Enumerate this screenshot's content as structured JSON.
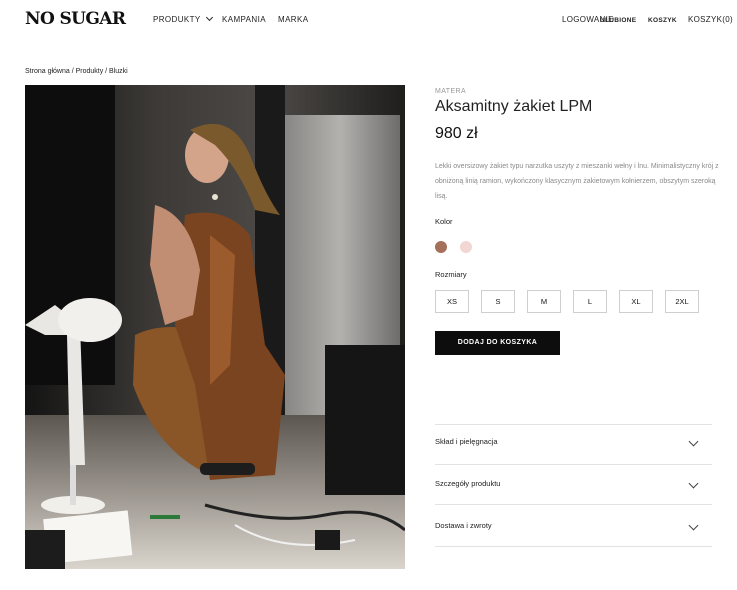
{
  "header": {
    "logo": "NO SUGAR",
    "nav": [
      {
        "label": "PRODUKTY"
      },
      {
        "label": "KAMPANIA"
      },
      {
        "label": "MARKA"
      }
    ],
    "login": "LOGOWANIE",
    "favorites": "ULUBIONE",
    "cart_bold": "KOSZYK",
    "cart_count": "KOSZYK(0)"
  },
  "breadcrumb": "Strona główna / Produkty / Bluzki",
  "product": {
    "brand": "MATERA",
    "title": "Aksamitny żakiet LPM",
    "price": "980 zł",
    "description": "Lekki oversizowy żakiet typu narzutka uszyty z mieszanki wełny i lnu. Minimalistyczny krój z obniżoną linią ramion, wykończony klasycznym żakietowym kołnierzem, obszytym szeroką lisą.",
    "color_label": "Kolor",
    "colors": [
      "#a4705a",
      "#f2d6d3"
    ],
    "size_label": "Rozmiary",
    "sizes": [
      "XS",
      "S",
      "M",
      "L",
      "XL",
      "2XL"
    ],
    "add_to_cart": "DODAJ DO KOSZYKA"
  },
  "accordion": [
    {
      "label": "Skład i pielęgnacja"
    },
    {
      "label": "Szczegóły produktu"
    },
    {
      "label": "Dostawa i zwroty"
    }
  ]
}
